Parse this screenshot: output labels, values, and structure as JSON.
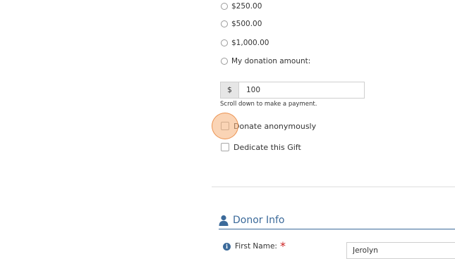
{
  "donation_options": [
    {
      "label": "$250.00"
    },
    {
      "label": "$500.00"
    },
    {
      "label": "$1,000.00"
    },
    {
      "label": "My donation amount:"
    }
  ],
  "amount": {
    "currency_symbol": "$",
    "value": "100"
  },
  "hint_text": "Scroll down to make a payment.",
  "checkboxes": {
    "anonymous": "Donate anonymously",
    "dedicate": "Dedicate this Gift"
  },
  "donor_info": {
    "title": "Donor Info",
    "first_name_label": "First Name:",
    "required_mark": "*",
    "info_glyph": "i",
    "first_name_value": "Jerolyn"
  },
  "colors": {
    "accent": "#3b6a9a",
    "required": "#cc2222",
    "highlight": "#f6b078"
  }
}
